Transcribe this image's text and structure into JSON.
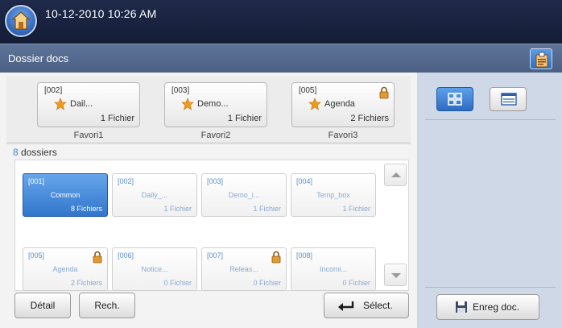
{
  "header": {
    "datetime": "10-12-2010 10:26 AM",
    "home_icon": "home-icon"
  },
  "titlebar": {
    "title": "Dossier docs",
    "icon": "settings-clipboard-icon"
  },
  "favorites": [
    {
      "code": "[002]",
      "name": "Dail...",
      "count": "1 Fichier",
      "caption": "Favori1",
      "locked": false
    },
    {
      "code": "[003]",
      "name": "Demo...",
      "count": "1 Fichier",
      "caption": "Favori2",
      "locked": false
    },
    {
      "code": "[005]",
      "name": "Agenda",
      "count": "2 Fichiers",
      "caption": "Favori3",
      "locked": true
    }
  ],
  "folder_count": {
    "number": "8",
    "label": " dossiers"
  },
  "folders": [
    {
      "code": "[001]",
      "name": "Common",
      "count": "8 Fichiers",
      "selected": true,
      "locked": false
    },
    {
      "code": "[002]",
      "name": "Daily_...",
      "count": "1 Fichier",
      "selected": false,
      "locked": false
    },
    {
      "code": "[003]",
      "name": "Demo_i...",
      "count": "1 Fichier",
      "selected": false,
      "locked": false
    },
    {
      "code": "[004]",
      "name": "Temp_box",
      "count": "1 Fichier",
      "selected": false,
      "locked": false
    },
    {
      "code": "[005]",
      "name": "Agenda",
      "count": "2 Fichiers",
      "selected": false,
      "locked": true
    },
    {
      "code": "[006]",
      "name": "Notice...",
      "count": "0 Fichier",
      "selected": false,
      "locked": false
    },
    {
      "code": "[007]",
      "name": "Releas...",
      "count": "0 Fichier",
      "selected": false,
      "locked": true
    },
    {
      "code": "[008]",
      "name": "Incomi...",
      "count": "0 Fichier",
      "selected": false,
      "locked": false
    }
  ],
  "buttons": {
    "detail": "Détail",
    "search": "Rech.",
    "select": "Sélect.",
    "save_doc": "Enreg doc."
  },
  "colors": {
    "accent_blue": "#3276cc",
    "top_bar": "#1a2440",
    "title_bar": "#54698d",
    "side_panel": "#cfd8e6",
    "lock": "#e39a2e",
    "star": "#f29a1a"
  }
}
